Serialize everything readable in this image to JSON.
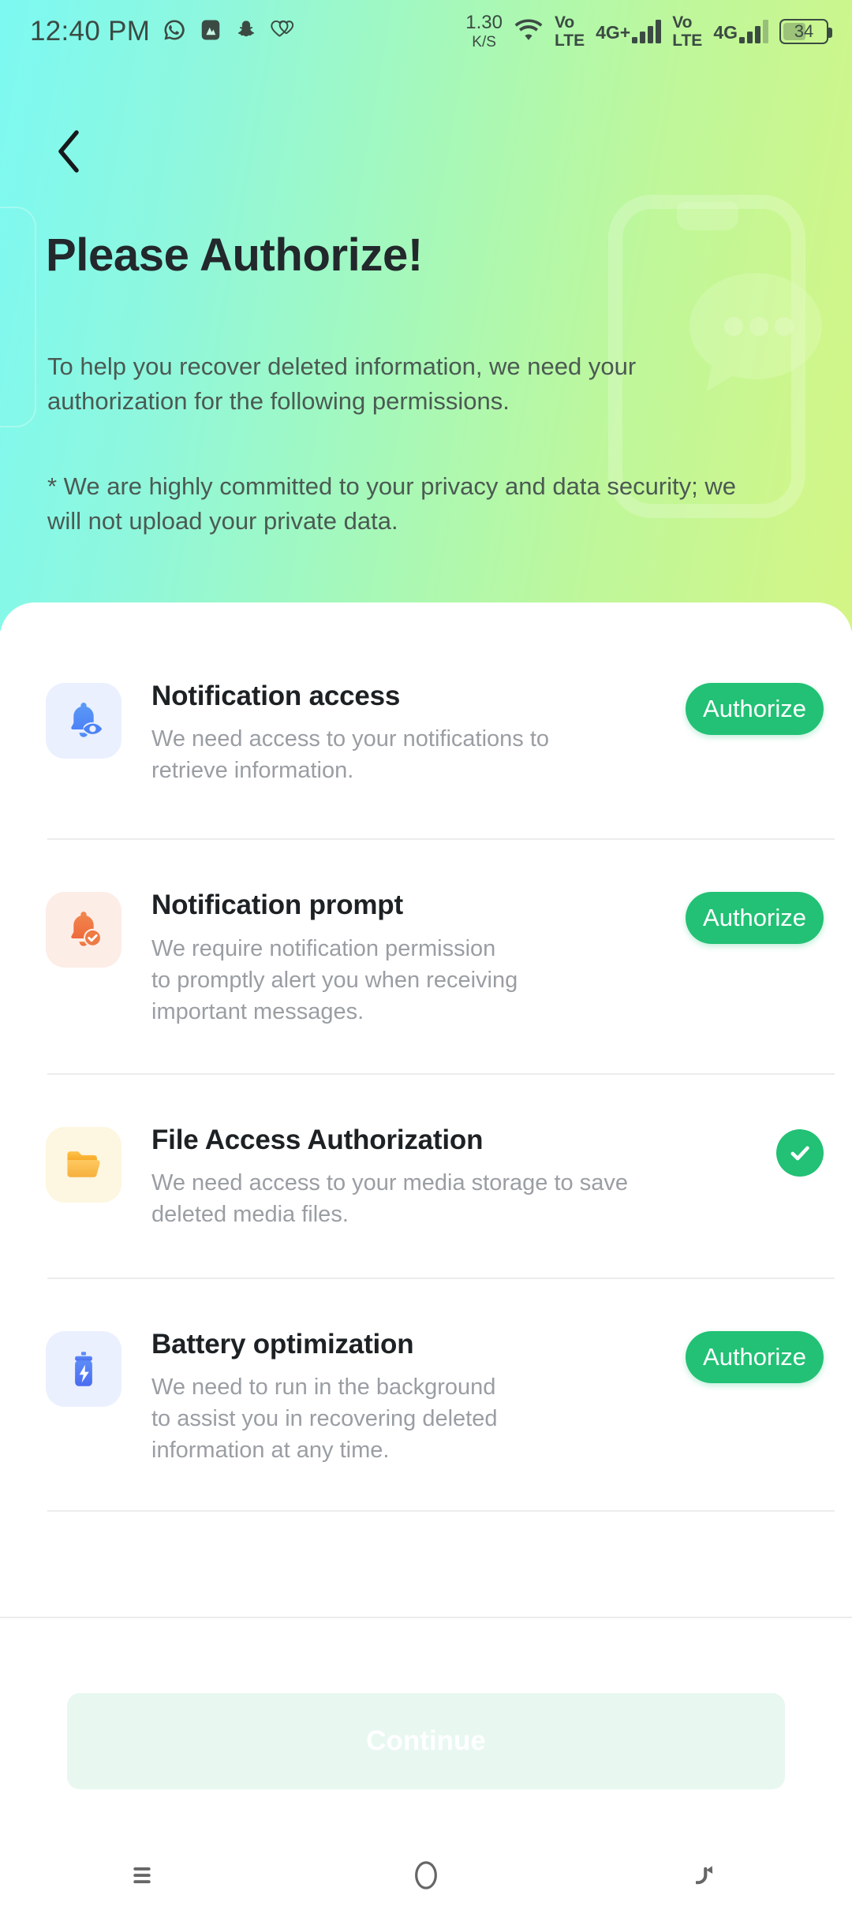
{
  "status_bar": {
    "time": "12:40 PM",
    "app_icons": [
      "whatsapp-icon",
      "gallery-icon",
      "snapchat-icon",
      "health-icon"
    ],
    "net_speed_value": "1.30",
    "net_speed_unit": "K/S",
    "wifi": "wifi-icon",
    "sim1_volte": [
      "Vo",
      "LTE"
    ],
    "sim1_network": "4G+",
    "sim2_volte": [
      "Vo",
      "LTE"
    ],
    "sim2_network": "4G",
    "battery_percent": "34"
  },
  "header": {
    "back_icon": "chevron-left-icon",
    "title": "Please Authorize!",
    "description": "To help you recover deleted information, we need your authorization for the following permissions.",
    "note": "* We are highly committed to your privacy and data security; we will not upload your private data.",
    "watermark_icon": "phone-chat-watermark-icon"
  },
  "permissions": [
    {
      "id": "notification-access",
      "icon": "bell-eye-icon",
      "icon_tile_color": "#EAF0FE",
      "title": "Notification access",
      "description": "We need access to your notifications to\nretrieve information.",
      "action_type": "button",
      "action_label": "Authorize",
      "granted": false
    },
    {
      "id": "notification-prompt",
      "icon": "bell-check-icon",
      "icon_tile_color": "#FDEDE7",
      "title": "Notification prompt",
      "description": "We require notification permission\nto promptly alert you when receiving\nimportant messages.",
      "action_type": "button",
      "action_label": "Authorize",
      "granted": false
    },
    {
      "id": "file-access-authorization",
      "icon": "folder-icon",
      "icon_tile_color": "#FDF6E0",
      "title": "File Access Authorization",
      "description": "We need access to your media storage to save\ndeleted media files.",
      "action_type": "granted-check",
      "action_label": "",
      "granted": true
    },
    {
      "id": "battery-optimization",
      "icon": "battery-bolt-icon",
      "icon_tile_color": "#EAF0FE",
      "title": "Battery optimization",
      "description": "We need to run in the background\nto assist you in recovering deleted\ninformation at any time.",
      "action_type": "button",
      "action_label": "Authorize",
      "granted": false
    }
  ],
  "footer": {
    "continue_label": "Continue",
    "continue_enabled": false
  },
  "nav_bar": {
    "recents_icon": "menu-icon",
    "home_icon": "home-circle-icon",
    "back_icon": "back-arrow-icon"
  },
  "colors": {
    "accent_green": "#22C175",
    "gradient_start": "#7DF9F2",
    "gradient_end": "#D4F585",
    "title_color": "#1D2124",
    "desc_color": "#9A9EA3"
  }
}
